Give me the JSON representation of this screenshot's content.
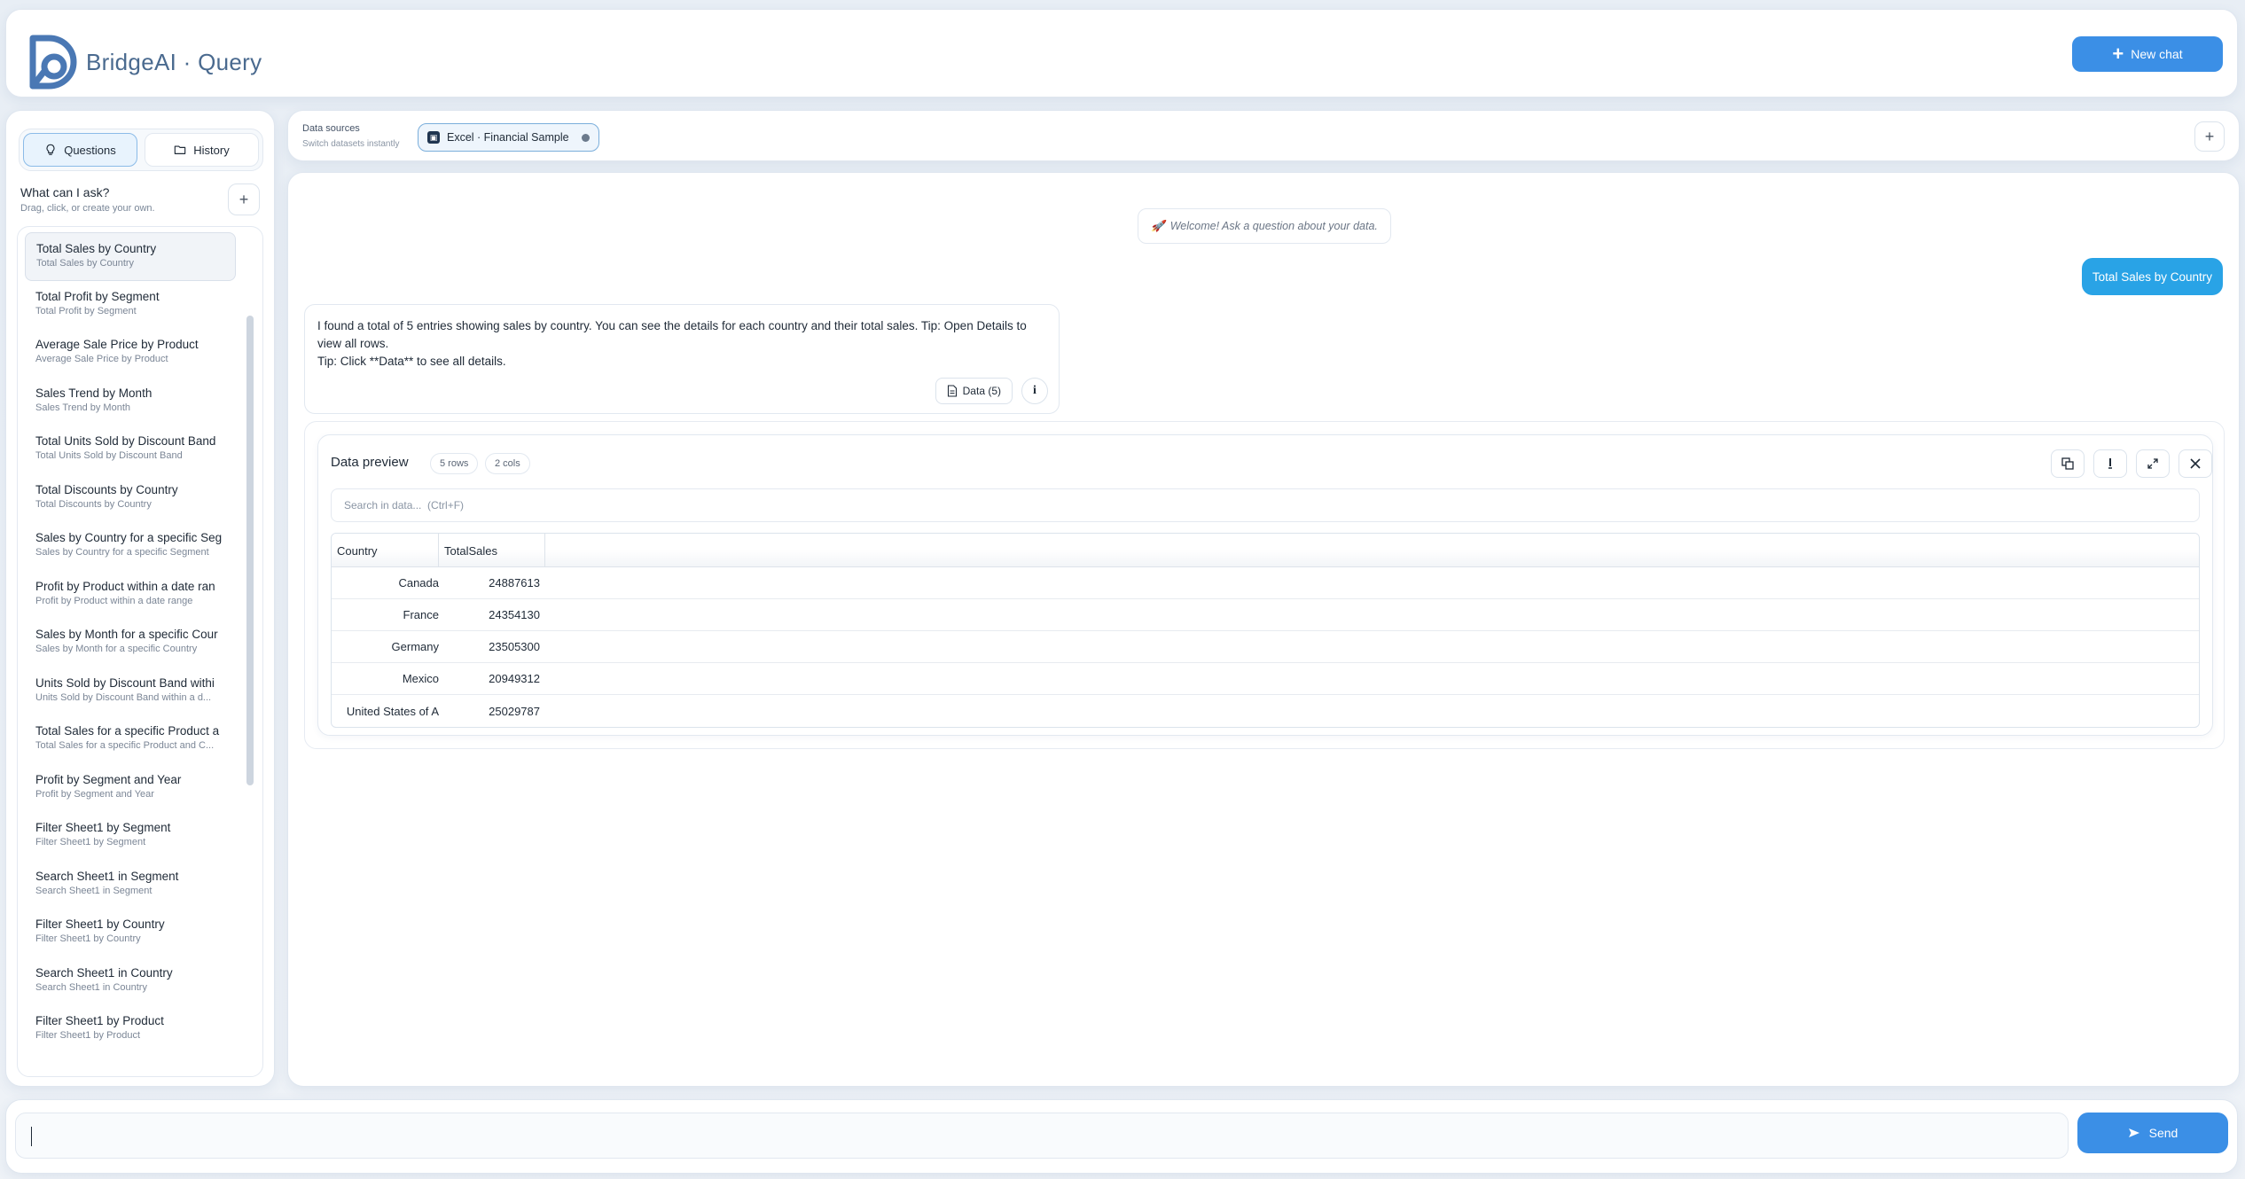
{
  "header": {
    "brand_name": "BridgeAI",
    "brand_separator": " · ",
    "brand_product": "Query",
    "new_chat_label": "New chat"
  },
  "sidebar": {
    "tabs": [
      {
        "label": "Questions",
        "icon": "lightbulb-icon",
        "active": true
      },
      {
        "label": "History",
        "icon": "folder-icon",
        "active": false
      }
    ],
    "ask_title": "What can I ask?",
    "ask_subtitle": "Drag, click, or create your own.",
    "questions": [
      {
        "title": "Total Sales by Country",
        "subtitle": "Total Sales by Country"
      },
      {
        "title": "Total Profit by Segment",
        "subtitle": "Total Profit by Segment"
      },
      {
        "title": "Average Sale Price by Product",
        "subtitle": "Average Sale Price by Product"
      },
      {
        "title": "Sales Trend by Month",
        "subtitle": "Sales Trend by Month"
      },
      {
        "title": "Total Units Sold by Discount Band",
        "subtitle": "Total Units Sold by Discount Band"
      },
      {
        "title": "Total Discounts by Country",
        "subtitle": "Total Discounts by Country"
      },
      {
        "title": "Sales by Country for a specific Seg",
        "subtitle": "Sales by Country for a specific Segment"
      },
      {
        "title": "Profit by Product within a date ran",
        "subtitle": "Profit by Product within a date range"
      },
      {
        "title": "Sales by Month for a specific Cour",
        "subtitle": "Sales by Month for a specific Country"
      },
      {
        "title": "Units Sold by Discount Band withi",
        "subtitle": "Units Sold by Discount Band within a d..."
      },
      {
        "title": "Total Sales for a specific Product a",
        "subtitle": "Total Sales for a specific Product and C..."
      },
      {
        "title": "Profit by Segment and Year",
        "subtitle": "Profit by Segment and Year"
      },
      {
        "title": "Filter Sheet1 by Segment",
        "subtitle": "Filter Sheet1 by Segment"
      },
      {
        "title": "Search Sheet1 in Segment",
        "subtitle": "Search Sheet1 in Segment"
      },
      {
        "title": "Filter Sheet1 by Country",
        "subtitle": "Filter Sheet1 by Country"
      },
      {
        "title": "Search Sheet1 in Country",
        "subtitle": "Search Sheet1 in Country"
      },
      {
        "title": "Filter Sheet1 by Product",
        "subtitle": "Filter Sheet1 by Product"
      }
    ]
  },
  "sources": {
    "label": "Data sources",
    "subtitle": "Switch datasets instantly",
    "chip_label": "Excel · Financial Sample"
  },
  "chat": {
    "welcome": "Welcome! Ask a question about your data.",
    "user_message": "Total Sales by Country",
    "bot_line1": "I found a total of 5 entries showing sales by country. You can see the details for each country and their total sales. Tip: Open Details to view all rows.",
    "bot_line2": "Tip: Click **Data** to see all details.",
    "data_button": "Data (5)"
  },
  "preview": {
    "title": "Data preview",
    "rows_badge": "5 rows",
    "cols_badge": "2 cols",
    "search_placeholder": "Search in data...  (Ctrl+F)",
    "columns": [
      "Country",
      "TotalSales"
    ],
    "rows": [
      [
        "Canada",
        "24887613"
      ],
      [
        "France",
        "24354130"
      ],
      [
        "Germany",
        "23505300"
      ],
      [
        "Mexico",
        "20949312"
      ],
      [
        "United States of A",
        "25029787"
      ]
    ]
  },
  "composer": {
    "input_value": "",
    "send_label": "Send"
  },
  "colors": {
    "accent": "#3b8fe6",
    "user_bubble": "#29a3e6",
    "brand": "#4a6a8f"
  }
}
